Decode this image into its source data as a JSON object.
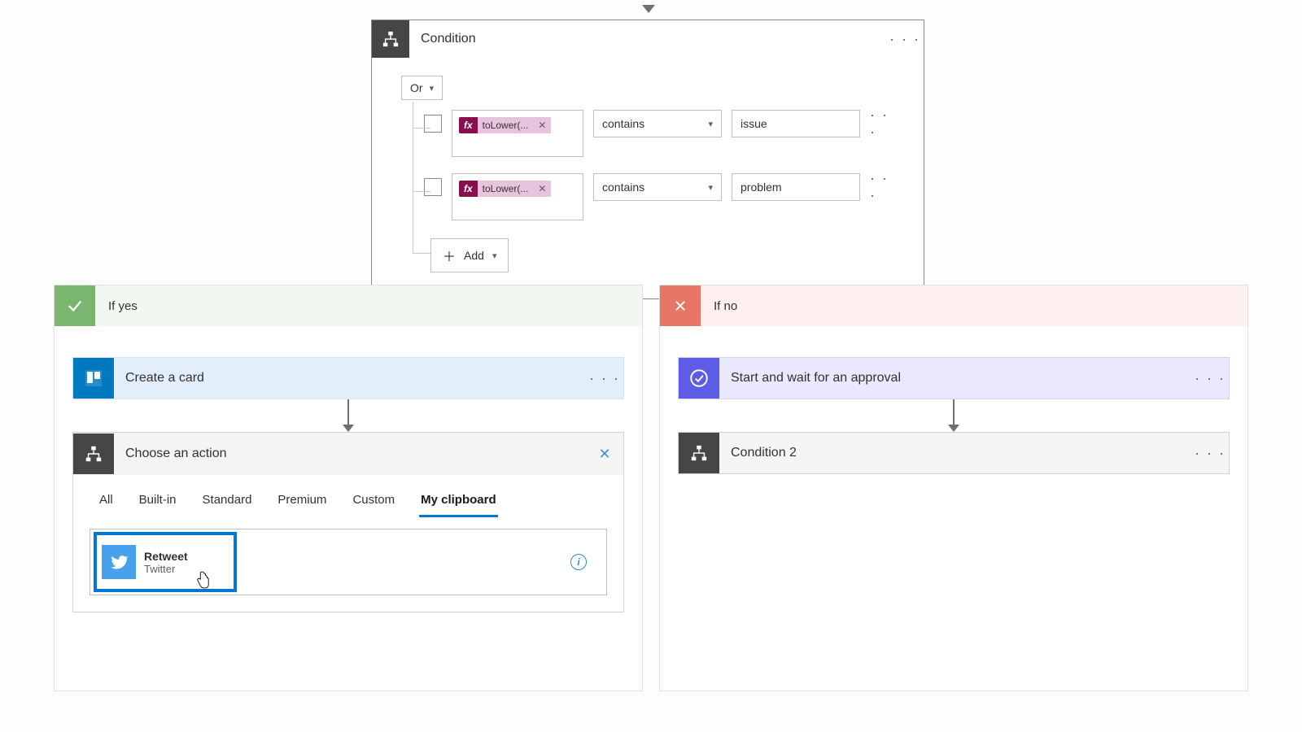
{
  "condition": {
    "title": "Condition",
    "group_operator": "Or",
    "add_label": "Add",
    "rows": [
      {
        "fx_prefix": "fx",
        "token": "toLower(...",
        "operator": "contains",
        "value": "issue"
      },
      {
        "fx_prefix": "fx",
        "token": "toLower(...",
        "operator": "contains",
        "value": "problem"
      }
    ]
  },
  "branches": {
    "yes": {
      "label": "If yes",
      "create_card": {
        "title": "Create a card"
      },
      "choose_action": {
        "title": "Choose an action",
        "tabs": [
          "All",
          "Built-in",
          "Standard",
          "Premium",
          "Custom",
          "My clipboard"
        ],
        "active_tab_index": 5,
        "clipboard_item": {
          "name": "Retweet",
          "connector": "Twitter"
        }
      }
    },
    "no": {
      "label": "If no",
      "approval": {
        "title": "Start and wait for an approval"
      },
      "condition2": {
        "title": "Condition 2"
      }
    }
  }
}
